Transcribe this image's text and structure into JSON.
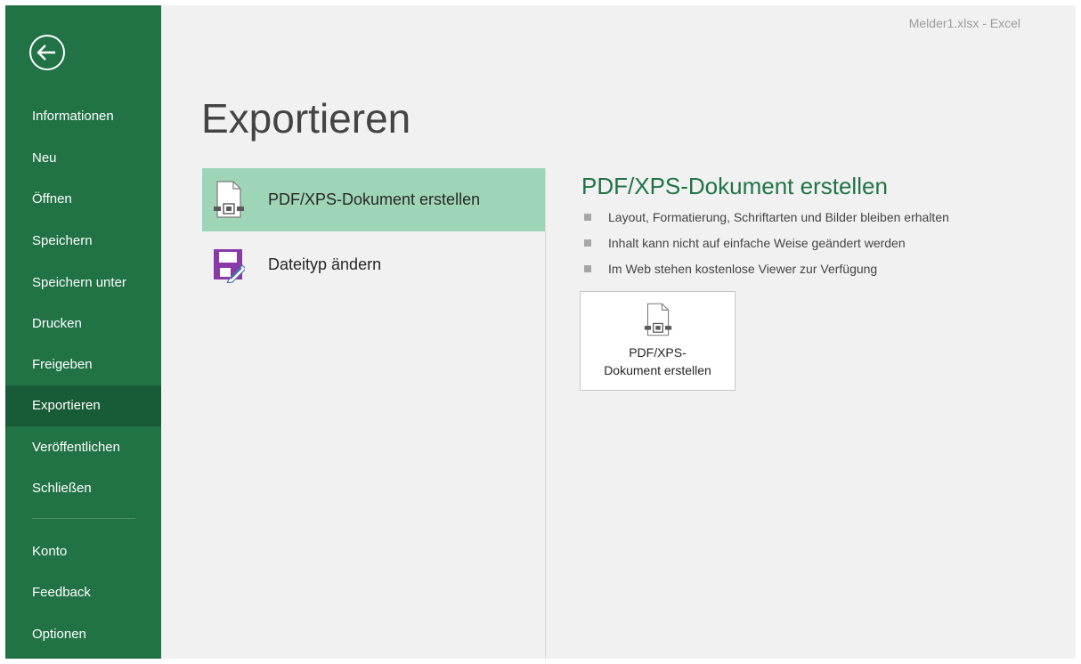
{
  "window": {
    "title": "Melder1.xlsx  -  Excel"
  },
  "sidebar": {
    "back_icon": "back-arrow-circle-icon",
    "items": [
      {
        "label": "Informationen",
        "active": false
      },
      {
        "label": "Neu",
        "active": false
      },
      {
        "label": "Öffnen",
        "active": false
      },
      {
        "label": "Speichern",
        "active": false
      },
      {
        "label": "Speichern unter",
        "active": false
      },
      {
        "label": "Drucken",
        "active": false
      },
      {
        "label": "Freigeben",
        "active": false
      },
      {
        "label": "Exportieren",
        "active": true
      },
      {
        "label": "Veröffentlichen",
        "active": false
      },
      {
        "label": "Schließen",
        "active": false
      },
      {
        "label": "Konto",
        "active": false
      },
      {
        "label": "Feedback",
        "active": false
      },
      {
        "label": "Optionen",
        "active": false
      }
    ]
  },
  "page": {
    "title": "Exportieren"
  },
  "options": [
    {
      "label": "PDF/XPS-Dokument erstellen",
      "icon": "pdf-document-icon",
      "selected": true
    },
    {
      "label": "Dateityp ändern",
      "icon": "change-file-type-icon",
      "selected": false
    }
  ],
  "detail": {
    "title": "PDF/XPS-Dokument erstellen",
    "bullets": [
      "Layout, Formatierung, Schriftarten und Bilder bleiben erhalten",
      "Inhalt kann nicht auf einfache Weise geändert werden",
      "Im Web stehen kostenlose Viewer zur Verfügung"
    ],
    "button_label": "PDF/XPS-\nDokument erstellen",
    "button_icon": "pdf-document-icon"
  },
  "colors": {
    "sidebar_bg": "#217346",
    "sidebar_active": "#185c37",
    "selected_option": "#9fd5b7",
    "accent_text": "#217346",
    "page_bg": "#f1f1f1"
  }
}
